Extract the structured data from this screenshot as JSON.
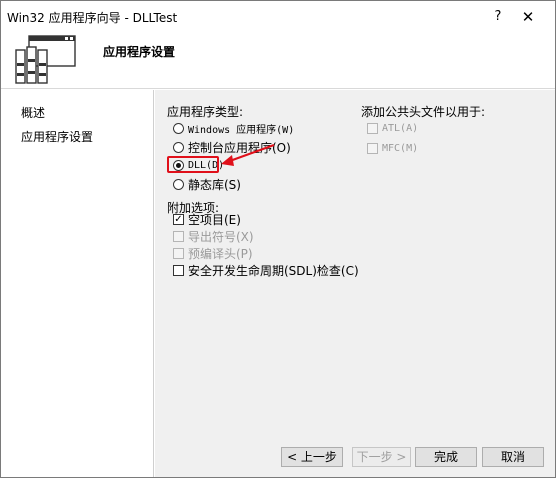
{
  "window": {
    "title": "Win32 应用程序向导 - DLLTest",
    "help_glyph": "?",
    "close_glyph": "✕"
  },
  "header": {
    "title": "应用程序设置"
  },
  "sidebar": {
    "items": [
      {
        "label": "概述"
      },
      {
        "label": "应用程序设置"
      }
    ]
  },
  "app_type": {
    "label": "应用程序类型:",
    "options": [
      {
        "label": "Windows 应用程序(W)",
        "checked": false
      },
      {
        "label": "控制台应用程序(O)",
        "checked": false
      },
      {
        "label": "DLL(D)",
        "checked": true
      },
      {
        "label": "静态库(S)",
        "checked": false
      }
    ]
  },
  "extra_options": {
    "label": "附加选项:",
    "options": [
      {
        "label": "空项目(E)",
        "checked": true,
        "enabled": true
      },
      {
        "label": "导出符号(X)",
        "checked": false,
        "enabled": false
      },
      {
        "label": "预编译头(P)",
        "checked": false,
        "enabled": false
      },
      {
        "label": "安全开发生命周期(SDL)检查(C)",
        "checked": false,
        "enabled": true
      }
    ]
  },
  "common_headers": {
    "label": "添加公共头文件以用于:",
    "options": [
      {
        "label": "ATL(A)",
        "checked": false,
        "enabled": false
      },
      {
        "label": "MFC(M)",
        "checked": false,
        "enabled": false
      }
    ]
  },
  "footer": {
    "prev": "< 上一步",
    "next": "下一步 >",
    "finish": "完成",
    "cancel": "取消"
  },
  "colors": {
    "annotation": "#e0101a"
  }
}
